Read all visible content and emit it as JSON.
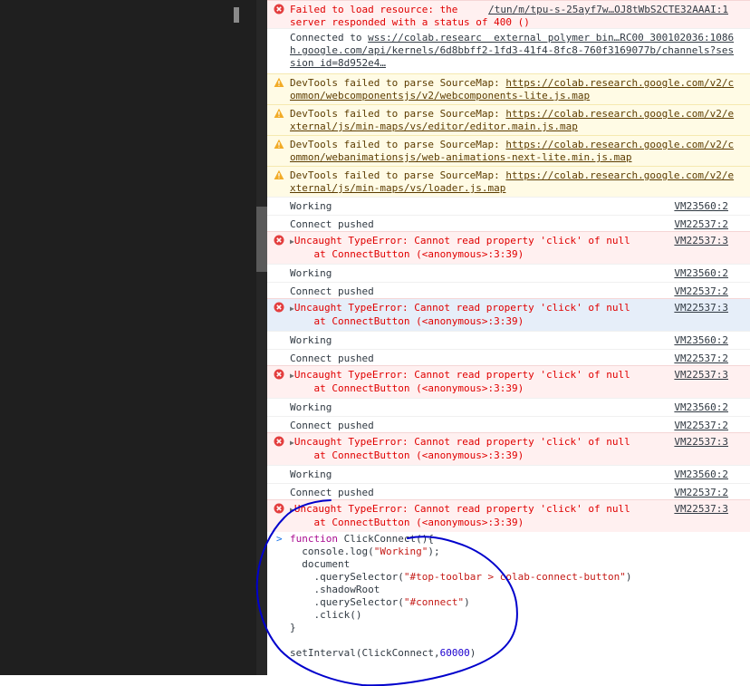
{
  "console": {
    "messages": [
      {
        "level": "error",
        "lines": [
          "Failed to load resource: the",
          "server responded with a status of 400 ()"
        ],
        "source": "/tun/m/tpu-s-25ayf7w…OJ8tWbS2CTE32AAAI:1"
      },
      {
        "level": "log",
        "lines": [
          "Connected to wss://colab.researc  external polymer bin…RC00 300102036:1086",
          "h.google.com/api/kernels/6d8bbff2-1fd3-41f4-8fc8-760f3169077b/channels?ses",
          "sion id=8d952e4…"
        ]
      },
      {
        "level": "warning",
        "lines": [
          "DevTools failed to parse SourceMap: https://colab.research.google.com/v2/c",
          "ommon/webcomponentsjs/v2/webcomponents-lite.js.map"
        ]
      },
      {
        "level": "warning",
        "lines": [
          "DevTools failed to parse SourceMap: https://colab.research.google.com/v2/e",
          "xternal/js/min-maps/vs/editor/editor.main.js.map"
        ]
      },
      {
        "level": "warning",
        "lines": [
          "DevTools failed to parse SourceMap: https://colab.research.google.com/v2/c",
          "ommon/webanimationsjs/web-animations-next-lite.min.js.map"
        ]
      },
      {
        "level": "warning",
        "lines": [
          "DevTools failed to parse SourceMap: https://colab.research.google.com/v2/e",
          "xternal/js/min-maps/vs/loader.js.map"
        ]
      },
      {
        "level": "log",
        "lines": [
          "Working"
        ],
        "source": "VM23560:2"
      },
      {
        "level": "log",
        "lines": [
          "Connect pushed"
        ],
        "source": "VM22537:2"
      },
      {
        "level": "error",
        "lines": [
          "Uncaught TypeError: Cannot read property 'click' of null",
          "    at ConnectButton (<anonymous>:3:39)"
        ],
        "source": "VM22537:3",
        "expandable": true
      },
      {
        "level": "log",
        "lines": [
          "Working"
        ],
        "source": "VM23560:2"
      },
      {
        "level": "log",
        "lines": [
          "Connect pushed"
        ],
        "source": "VM22537:2"
      },
      {
        "level": "error",
        "lines": [
          "Uncaught TypeError: Cannot read property 'click' of null",
          "    at ConnectButton (<anonymous>:3:39)"
        ],
        "source": "VM22537:3",
        "expandable": true,
        "highlighted": true
      },
      {
        "level": "log",
        "lines": [
          "Working"
        ],
        "source": "VM23560:2"
      },
      {
        "level": "log",
        "lines": [
          "Connect pushed"
        ],
        "source": "VM22537:2"
      },
      {
        "level": "error",
        "lines": [
          "Uncaught TypeError: Cannot read property 'click' of null",
          "    at ConnectButton (<anonymous>:3:39)"
        ],
        "source": "VM22537:3",
        "expandable": true
      },
      {
        "level": "log",
        "lines": [
          "Working"
        ],
        "source": "VM23560:2"
      },
      {
        "level": "log",
        "lines": [
          "Connect pushed"
        ],
        "source": "VM22537:2"
      },
      {
        "level": "error",
        "lines": [
          "Uncaught TypeError: Cannot read property 'click' of null",
          "    at ConnectButton (<anonymous>:3:39)"
        ],
        "source": "VM22537:3",
        "expandable": true
      },
      {
        "level": "log",
        "lines": [
          "Working"
        ],
        "source": "VM23560:2"
      },
      {
        "level": "log",
        "lines": [
          "Connect pushed"
        ],
        "source": "VM22537:2"
      },
      {
        "level": "error",
        "lines": [
          "Uncaught TypeError: Cannot read property 'click' of null",
          "    at ConnectButton (<anonymous>:3:39)"
        ],
        "source": "VM22537:3",
        "expandable": true
      }
    ],
    "prompt_symbol": ">",
    "code_lines": [
      "function ClickConnect(){",
      "  console.log(\"Working\");",
      "  document",
      "    .querySelector(\"#top-toolbar > colab-connect-button\")",
      "    .shadowRoot",
      "    .querySelector(\"#connect\")",
      "    .click()",
      "}",
      "",
      "setInterval(ClickConnect,60000)"
    ]
  },
  "colors": {
    "error": "#e00000",
    "warning": "#5c3c00",
    "annotation": "#0000cc"
  },
  "icons": {
    "error": "error-circle-icon",
    "warning": "warning-triangle-icon",
    "expand": "expand-triangle-icon",
    "prompt": "prompt-chevron-icon"
  }
}
